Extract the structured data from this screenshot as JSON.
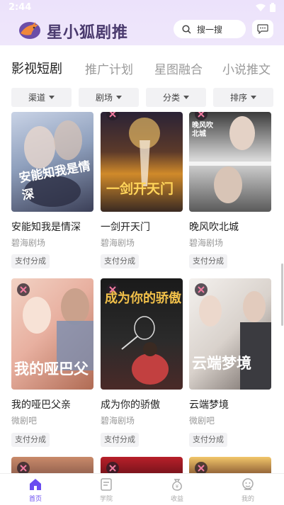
{
  "status_bar": {
    "time": "2:44"
  },
  "app": {
    "title": "星小狐剧推"
  },
  "search": {
    "placeholder": "搜一搜"
  },
  "tabs": [
    {
      "label": "影视短剧",
      "active": true
    },
    {
      "label": "推广计划",
      "active": false
    },
    {
      "label": "星图融合",
      "active": false
    },
    {
      "label": "小说推文",
      "active": false
    }
  ],
  "filters": [
    {
      "label": "渠道"
    },
    {
      "label": "剧场"
    },
    {
      "label": "分类"
    },
    {
      "label": "排序"
    }
  ],
  "dramas": [
    {
      "title": "安能知我是情深",
      "studio": "碧海剧场",
      "tag": "支付分成",
      "poster_text": "安能知我是情深"
    },
    {
      "title": "一剑开天门",
      "studio": "碧海剧场",
      "tag": "支付分成",
      "poster_text": "一剑开天门"
    },
    {
      "title": "晚风吹北城",
      "studio": "碧海剧场",
      "tag": "支付分成",
      "poster_text": "晚风吹北城"
    },
    {
      "title": "我的哑巴父亲",
      "studio": "微剧吧",
      "tag": "支付分成",
      "poster_text": "我的哑巴父"
    },
    {
      "title": "成为你的骄傲",
      "studio": "碧海剧场",
      "tag": "支付分成",
      "poster_text": "成为你的骄傲"
    },
    {
      "title": "云端梦境",
      "studio": "微剧吧",
      "tag": "支付分成",
      "poster_text": "云端梦境"
    }
  ],
  "bottom_nav": [
    {
      "label": "首页",
      "icon": "home-icon",
      "active": true
    },
    {
      "label": "学院",
      "icon": "book-icon",
      "active": false
    },
    {
      "label": "收益",
      "icon": "money-bag-icon",
      "active": false
    },
    {
      "label": "我的",
      "icon": "profile-icon",
      "active": false
    }
  ],
  "colors": {
    "accent": "#6a4cf0",
    "header_bg": "#ece2fb",
    "title": "#4a3a6e"
  }
}
